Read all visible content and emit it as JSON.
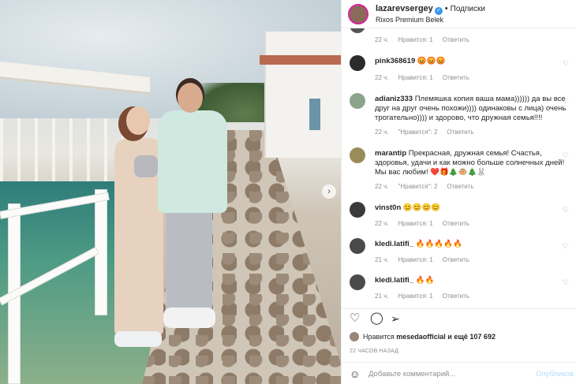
{
  "header": {
    "username": "lazarevsergey",
    "follow_label": "Подписки",
    "location": "Rixos Premium Belek"
  },
  "top_comment_footer": {
    "time": "22 ч.",
    "likes": "Нравится: 1",
    "reply": "Ответить"
  },
  "comments": [
    {
      "user": "pink368619",
      "text": "😡😡😡",
      "time": "22 ч.",
      "likes": "Нравится: 1",
      "reply": "Ответить"
    },
    {
      "user": "adianiz333",
      "text": "Племяшка копия ваша мама)))))) да вы все друг на друг очень похожи)))) одинаковы с лица) очень трогательно)))) и здорово, что дружная семья!!!!",
      "time": "22 ч.",
      "likes": "\"Нравится\": 2",
      "reply": "Ответить"
    },
    {
      "user": "marantip",
      "text": "Прекрасная, дружная семья! Счастья, здоровья, удачи и как можно больше солнечных дней! Мы вас любим! ❤️🎁🎄🐵🎄🐰",
      "time": "22 ч.",
      "likes": "\"Нравится\": 2",
      "reply": "Ответить"
    },
    {
      "user": "vinst0n",
      "text": "😊😊😊😊",
      "time": "22 ч.",
      "likes": "Нравится: 1",
      "reply": "Ответить"
    },
    {
      "user": "kledi.latifi_",
      "text": "🔥🔥🔥🔥🔥",
      "time": "21 ч.",
      "likes": "Нравится: 1",
      "reply": "Ответить"
    },
    {
      "user": "kledi.latifi_",
      "text": "🔥🔥",
      "time": "21 ч.",
      "likes": "Нравится: 1",
      "reply": "Ответить"
    }
  ],
  "likes": {
    "prefix": "Нравится",
    "user": "mesedaofficial",
    "suffix": "и ещё 107 692"
  },
  "timestamp": "22 ЧАСОВ НАЗАД",
  "add_comment": {
    "placeholder": "Добавьте комментарий...",
    "publish_label": "Опубликов"
  },
  "colors": {
    "verified": "#3897f0",
    "story_ring": "#d6249f",
    "publish_disabled": "#b3dbff"
  }
}
